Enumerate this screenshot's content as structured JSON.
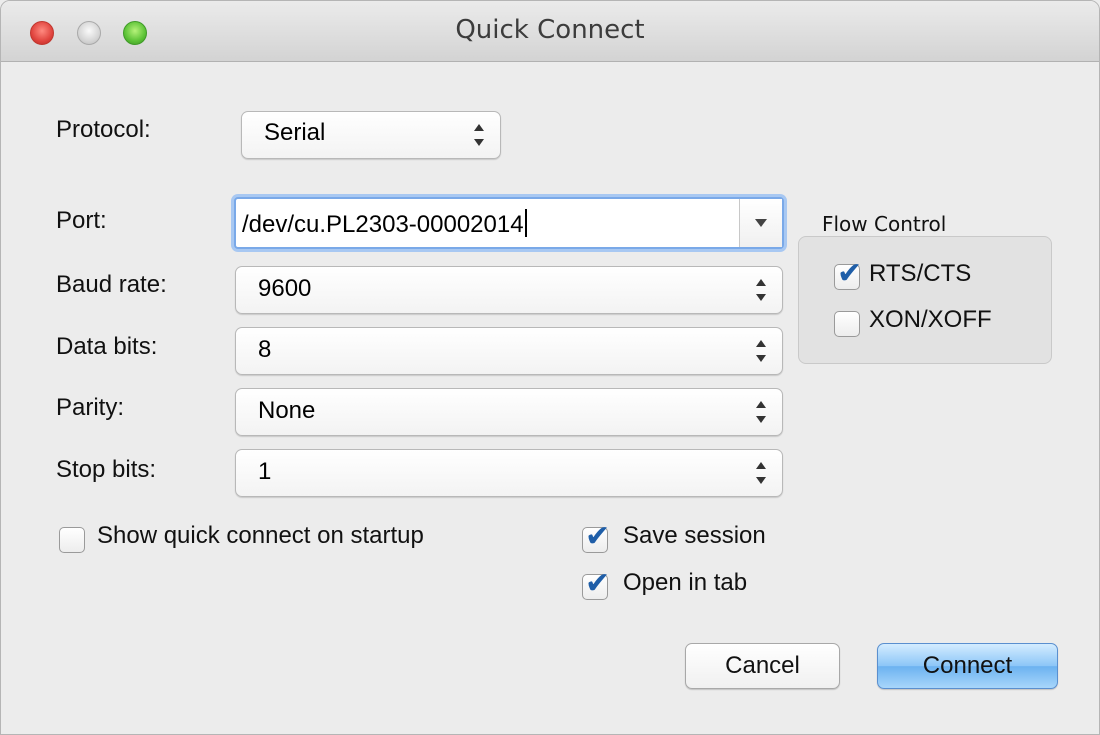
{
  "window": {
    "title": "Quick Connect"
  },
  "protocol": {
    "label": "Protocol:",
    "value": "Serial"
  },
  "port": {
    "label": "Port:",
    "value": "/dev/cu.PL2303-00002014"
  },
  "baud_rate": {
    "label": "Baud rate:",
    "value": "9600"
  },
  "data_bits": {
    "label": "Data bits:",
    "value": "8"
  },
  "parity": {
    "label": "Parity:",
    "value": "None"
  },
  "stop_bits": {
    "label": "Stop bits:",
    "value": "1"
  },
  "flow_control": {
    "title": "Flow Control",
    "rts_cts": {
      "label": "RTS/CTS",
      "checked": true
    },
    "xon_xoff": {
      "label": "XON/XOFF",
      "checked": false
    }
  },
  "options": {
    "show_quick_connect": {
      "label": "Show quick connect on startup",
      "checked": false
    },
    "save_session": {
      "label": "Save session",
      "checked": true
    },
    "open_in_tab": {
      "label": "Open in tab",
      "checked": true
    }
  },
  "buttons": {
    "cancel": "Cancel",
    "connect": "Connect"
  },
  "colors": {
    "accent": "#1f5ea8",
    "focus_ring": "#a8c8f2",
    "default_button": "#8cc6f7"
  }
}
